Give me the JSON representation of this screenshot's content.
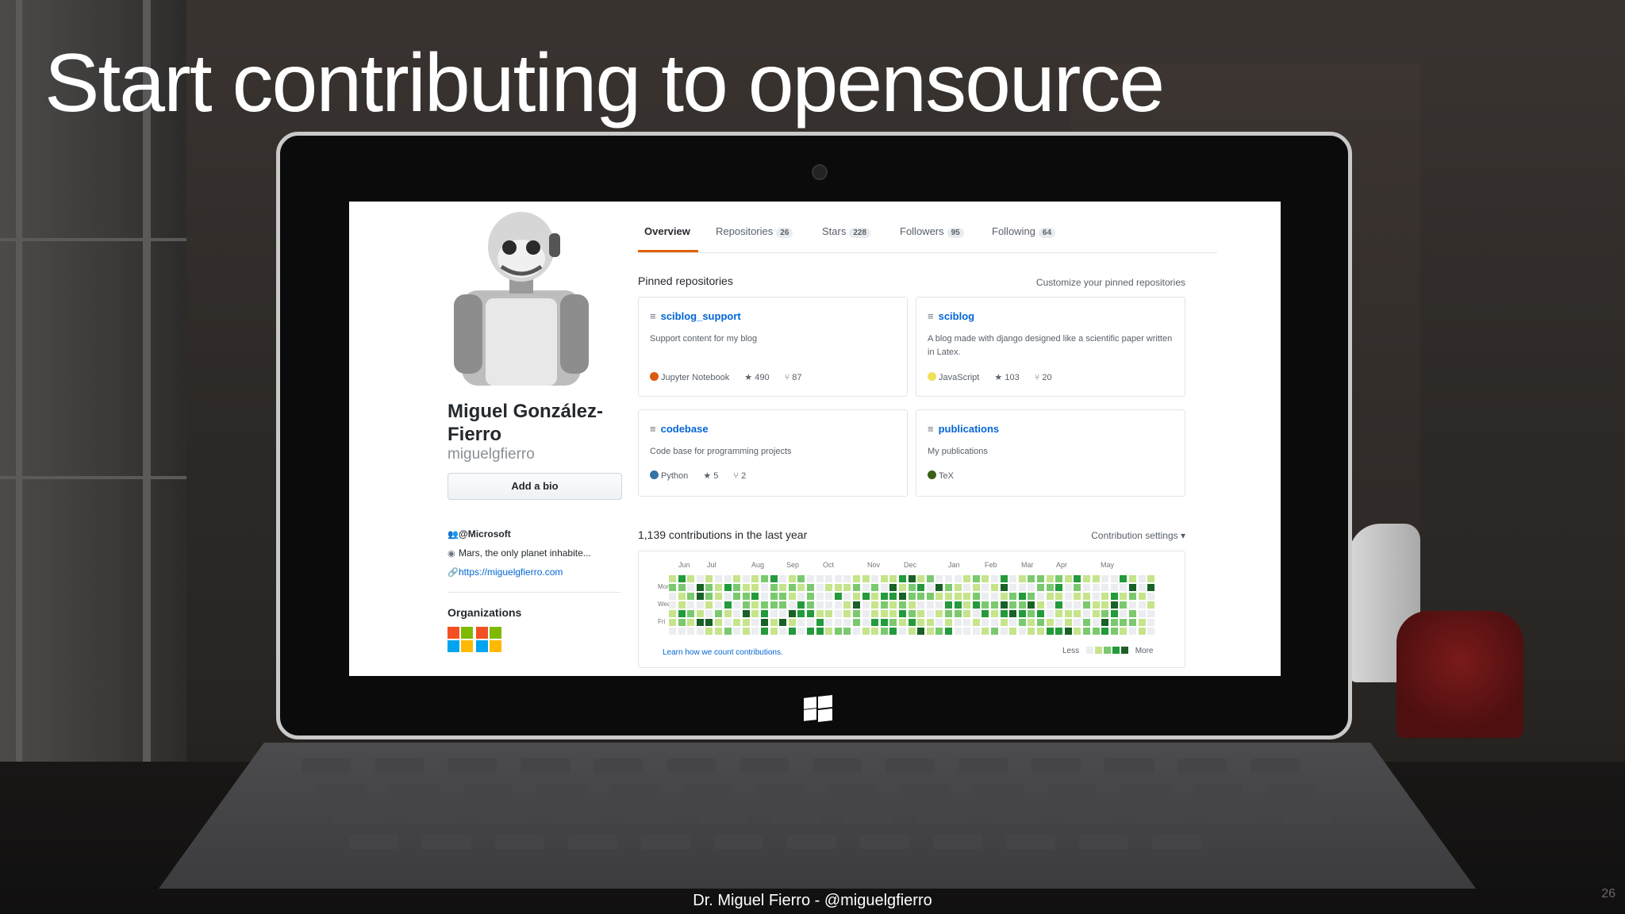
{
  "slide": {
    "title": "Start contributing to opensource",
    "footer": "Dr. Miguel Fierro - @miguelgfierro",
    "page_number": "26"
  },
  "profile": {
    "avatar_icon": "robot-avatar-icon",
    "name": "Miguel González-Fierro",
    "login": "miguelgfierro",
    "add_bio_label": "Add a bio",
    "company": "@Microsoft",
    "location": "Mars, the only planet inhabite...",
    "website": "https://miguelgfierro.com",
    "organizations_title": "Organizations",
    "organizations": [
      {
        "icon": "microsoft-org-icon",
        "colors": [
          "#f25022",
          "#7fba00",
          "#00a4ef",
          "#ffb900"
        ]
      },
      {
        "icon": "microsoft-org-icon",
        "colors": [
          "#f25022",
          "#7fba00",
          "#00a4ef",
          "#ffb900"
        ]
      }
    ]
  },
  "tabs": [
    {
      "label": "Overview",
      "count": ""
    },
    {
      "label": "Repositories",
      "count": "26"
    },
    {
      "label": "Stars",
      "count": "228"
    },
    {
      "label": "Followers",
      "count": "95"
    },
    {
      "label": "Following",
      "count": "64"
    }
  ],
  "pinned": {
    "title": "Pinned repositories",
    "customize": "Customize your pinned repositories",
    "repos": [
      {
        "name": "sciblog_support",
        "description": "Support content for my blog",
        "language": "Jupyter Notebook",
        "language_color": "#DA5B0B",
        "stars": "490",
        "forks": "87"
      },
      {
        "name": "sciblog",
        "description": "A blog made with django designed like a scientific paper written in Latex.",
        "language": "JavaScript",
        "language_color": "#f1e05a",
        "stars": "103",
        "forks": "20"
      },
      {
        "name": "codebase",
        "description": "Code base for programming projects",
        "language": "Python",
        "language_color": "#3572A5",
        "stars": "5",
        "forks": "2"
      },
      {
        "name": "publications",
        "description": "My publications",
        "language": "TeX",
        "language_color": "#3D6117",
        "stars": "",
        "forks": ""
      }
    ]
  },
  "contributions": {
    "title": "1,139 contributions in the last year",
    "settings": "Contribution settings ▾",
    "months": [
      "Jun",
      "Jul",
      "Aug",
      "Sep",
      "Oct",
      "Nov",
      "Dec",
      "Jan",
      "Feb",
      "Mar",
      "Apr",
      "May"
    ],
    "days": [
      "Mon",
      "Wed",
      "Fri"
    ],
    "learn_link": "Learn how we count contributions.",
    "legend_less": "Less",
    "legend_more": "More",
    "palette": [
      "#ebedf0",
      "#c6e48b",
      "#7bc96f",
      "#239a3b",
      "#196127"
    ]
  }
}
